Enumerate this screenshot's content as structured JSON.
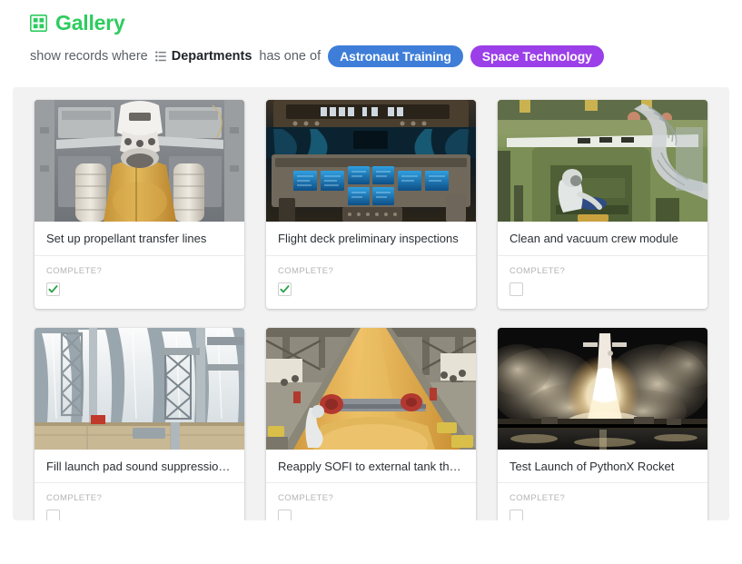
{
  "header": {
    "icon": "grid-icon",
    "title": "Gallery",
    "title_color": "#2ecc5f"
  },
  "filter": {
    "prefix": "show records where",
    "field_icon": "multiselect-icon",
    "field_name": "Departments",
    "operator": "has one of",
    "values": [
      {
        "label": "Astronaut Training",
        "color": "#3f7ed8"
      },
      {
        "label": "Space Technology",
        "color": "#9b3fe8"
      }
    ]
  },
  "gallery": {
    "field_label": "COMPLETE?",
    "cards": [
      {
        "title": "Set up propellant transfer lines",
        "complete": true,
        "image": "space-shuttle-on-launch-pad-aerial"
      },
      {
        "title": "Flight deck preliminary inspections",
        "complete": true,
        "image": "shuttle-flight-deck-cockpit"
      },
      {
        "title": "Clean and vacuum crew module",
        "complete": false,
        "image": "crew-module-interior-technician"
      },
      {
        "title": "Fill launch pad sound suppression …",
        "complete": false,
        "image": "launch-pad-water-deluge"
      },
      {
        "title": "Reapply SOFI to external tank ther…",
        "complete": false,
        "image": "external-tank-foam-hangar"
      },
      {
        "title": "Test Launch of PythonX Rocket",
        "complete": false,
        "image": "night-rocket-launch"
      }
    ]
  }
}
